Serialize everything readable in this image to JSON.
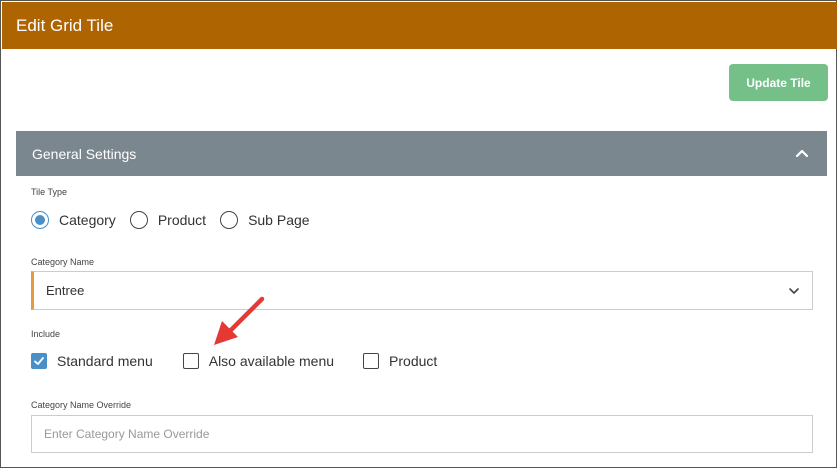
{
  "dialog": {
    "title": "Edit Grid Tile",
    "update_button": "Update Tile"
  },
  "section": {
    "title": "General Settings",
    "collapse_icon": "chevron-up-icon",
    "tile_type": {
      "label": "Tile Type",
      "options": [
        {
          "label": "Category",
          "selected": true
        },
        {
          "label": "Product",
          "selected": false
        },
        {
          "label": "Sub Page",
          "selected": false
        }
      ]
    },
    "category_name": {
      "label": "Category Name",
      "value": "Entree",
      "dropdown_icon": "chevron-down-icon"
    },
    "include": {
      "label": "Include",
      "options": [
        {
          "label": "Standard menu",
          "checked": true
        },
        {
          "label": "Also available menu",
          "checked": false
        },
        {
          "label": "Product",
          "checked": false
        }
      ]
    },
    "override": {
      "label": "Category Name Override",
      "placeholder": "Enter Category Name Override",
      "value": ""
    }
  },
  "colors": {
    "titlebar": "#ae6400",
    "update_button": "#74c088",
    "section_header": "#7b878e",
    "accent_blue": "#4a90c8",
    "select_accent": "#e59a3c",
    "annotation_arrow": "#e53935"
  }
}
